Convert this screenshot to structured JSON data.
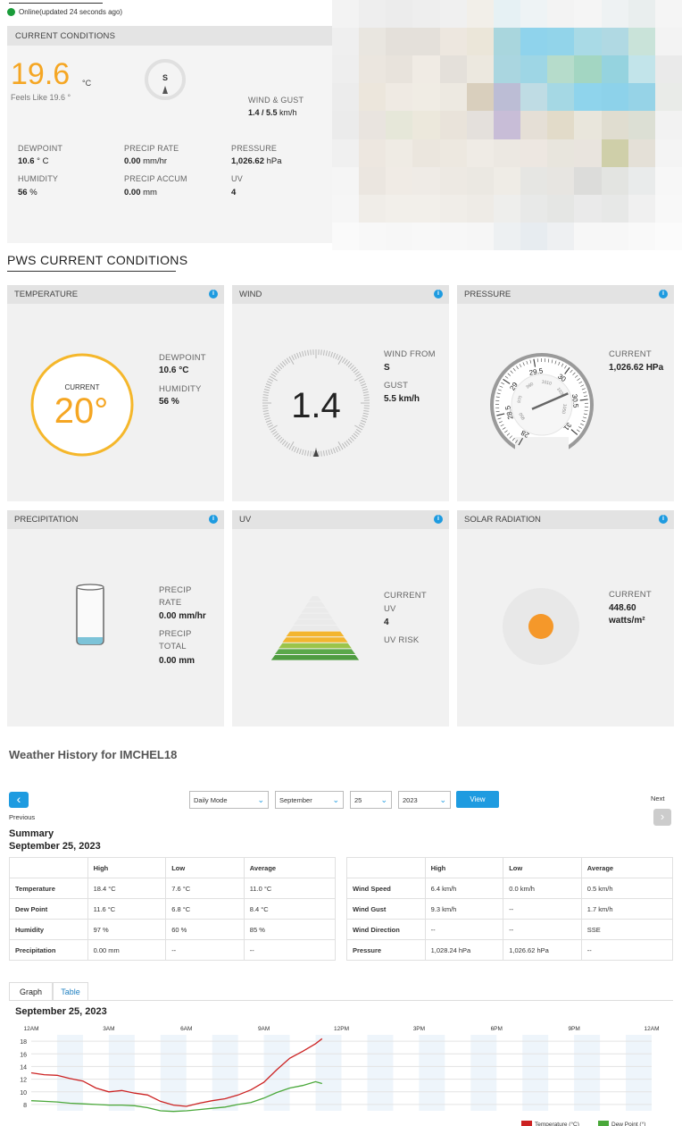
{
  "status": {
    "text": "Online(updated 24 seconds ago)",
    "color": "#1a9c3a"
  },
  "current": {
    "header": "CURRENT CONDITIONS",
    "temp": "19.6",
    "temp_unit": "°C",
    "feels_like": "Feels Like 19.6 °",
    "wind_dir": "S",
    "wind_gust_label": "WIND & GUST",
    "wind_gust_value": "1.4  / 5.5",
    "wind_gust_unit": "km/h",
    "dewpoint_label": "DEWPOINT",
    "dewpoint_value": "10.6",
    "dewpoint_unit": " ° C",
    "precip_rate_label": "PRECIP RATE",
    "precip_rate_value": "0.00",
    "precip_rate_unit": " mm/hr",
    "pressure_label": "PRESSURE",
    "pressure_value": "1,026.62",
    "pressure_unit": " hPa",
    "humidity_label": "HUMIDITY",
    "humidity_value": "56",
    "humidity_unit": "  %",
    "precip_accum_label": "PRECIP ACCUM",
    "precip_accum_value": "0.00",
    "precip_accum_unit": "  mm",
    "uv_label": "UV",
    "uv_value": "4"
  },
  "pws": {
    "title": "PWS CURRENT CONDITIONS",
    "temperature": {
      "header": "TEMPERATURE",
      "gauge_label": "CURRENT",
      "gauge_value": "20°",
      "dewpoint_label": "DEWPOINT",
      "dewpoint_value": "10.6 °C",
      "humidity_label": "HUMIDITY",
      "humidity_value": "56 %"
    },
    "wind": {
      "header": "WIND",
      "gauge_value": "1.4",
      "from_label": "WIND FROM",
      "from_value": "S",
      "gust_label": "GUST",
      "gust_value": "5.5 km/h"
    },
    "pressure": {
      "header": "PRESSURE",
      "current_label": "CURRENT",
      "current_value": "1,026.62 HPa",
      "ticks": [
        "28",
        "28.5",
        "29",
        "29.5",
        "30",
        "30.5",
        "31"
      ],
      "inner_ticks": [
        "950",
        "970",
        "990",
        "1010",
        "1030",
        "1050"
      ],
      "value_inhg": 30.32
    },
    "precipitation": {
      "header": "PRECIPITATION",
      "rate_label_1": "PRECIP",
      "rate_label_2": "RATE",
      "rate_value": "0.00 mm/hr",
      "total_label_1": "PRECIP",
      "total_label_2": "TOTAL",
      "total_value": "0.00 mm"
    },
    "uv": {
      "header": "UV",
      "current_label_1": "CURRENT",
      "current_label_2": "UV",
      "current_value": "4",
      "risk_label": "UV RISK"
    },
    "solar": {
      "header": "SOLAR RADIATION",
      "current_label": "CURRENT",
      "current_value": "448.60",
      "current_unit": "watts/m²"
    }
  },
  "history": {
    "title": "Weather History for IMCHEL18",
    "prev_label": "Previous",
    "next_label": "Next",
    "mode": "Daily Mode",
    "month": "September",
    "day": "25",
    "year": "2023",
    "view_label": "View",
    "summary_label": "Summary",
    "summary_date": "September 25, 2023",
    "table_left": {
      "headers": [
        "",
        "High",
        "Low",
        "Average"
      ],
      "rows": [
        [
          "Temperature",
          "18.4 °C",
          "7.6 °C",
          "11.0 °C"
        ],
        [
          "Dew Point",
          "11.6 °C",
          "6.8 °C",
          "8.4 °C"
        ],
        [
          "Humidity",
          "97 %",
          "60 %",
          "85 %"
        ],
        [
          "Precipitation",
          "0.00 mm",
          "--",
          "--"
        ]
      ]
    },
    "table_right": {
      "headers": [
        "",
        "High",
        "Low",
        "Average"
      ],
      "rows": [
        [
          "Wind Speed",
          "6.4 km/h",
          "0.0 km/h",
          "0.5 km/h"
        ],
        [
          "Wind Gust",
          "9.3 km/h",
          "--",
          "1.7 km/h"
        ],
        [
          "Wind Direction",
          "--",
          "--",
          "SSE"
        ],
        [
          "Pressure",
          "1,028.24 hPa",
          "1,026.62 hPa",
          "--"
        ]
      ]
    },
    "tabs": [
      "Graph",
      "Table"
    ],
    "chart_date": "September 25, 2023"
  },
  "chart_data": {
    "type": "line",
    "x_ticks": [
      "12AM",
      "3AM",
      "6AM",
      "9AM",
      "12PM",
      "3PM",
      "6PM",
      "9PM",
      "12AM"
    ],
    "y_ticks": [
      8,
      10,
      12,
      14,
      16,
      18
    ],
    "ylim": [
      7,
      19
    ],
    "x_hours_range": [
      0,
      24
    ],
    "series": [
      {
        "name": "Temperature (°C)",
        "color": "#cc2222",
        "x": [
          0,
          0.5,
          1,
          1.5,
          2,
          2.5,
          3,
          3.5,
          4,
          4.5,
          5,
          5.5,
          6,
          6.5,
          7,
          7.5,
          8,
          8.5,
          9,
          9.5,
          10,
          10.5,
          11,
          11.25
        ],
        "y": [
          13.0,
          12.7,
          12.6,
          12.1,
          11.7,
          10.6,
          10.0,
          10.2,
          9.8,
          9.5,
          8.5,
          7.9,
          7.7,
          8.2,
          8.6,
          8.9,
          9.5,
          10.3,
          11.5,
          13.5,
          15.3,
          16.4,
          17.6,
          18.4
        ]
      },
      {
        "name": "Dew Point (°)",
        "color": "#4aa83a",
        "x": [
          0,
          0.5,
          1,
          1.5,
          2,
          2.5,
          3,
          3.5,
          4,
          4.5,
          5,
          5.5,
          6,
          6.5,
          7,
          7.5,
          8,
          8.5,
          9,
          9.5,
          10,
          10.5,
          11,
          11.25
        ],
        "y": [
          8.6,
          8.5,
          8.4,
          8.2,
          8.1,
          8.0,
          7.9,
          7.9,
          7.8,
          7.5,
          7.0,
          6.9,
          7.0,
          7.2,
          7.4,
          7.6,
          8.0,
          8.3,
          9.0,
          9.9,
          10.6,
          11.0,
          11.6,
          11.3
        ]
      }
    ]
  }
}
